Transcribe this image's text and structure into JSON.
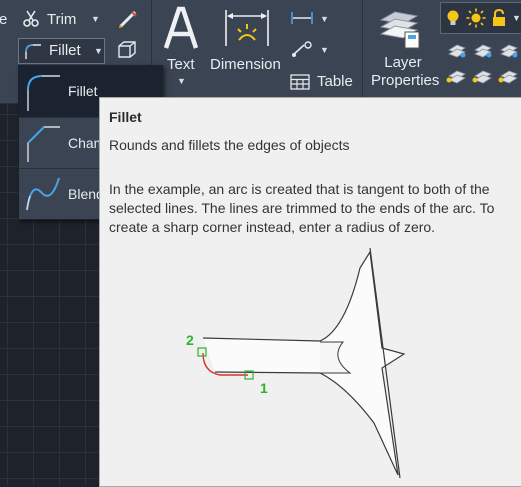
{
  "ribbon": {
    "trim_label": "Trim",
    "fillet_label": "Fillet",
    "text_label": "Text",
    "dimension_label": "Dimension",
    "table_label": "Table",
    "layer_properties_label": "Layer\nProperties",
    "cut_left_top": "e",
    "cut_left_mid": "y"
  },
  "flyout": {
    "items": [
      {
        "label": "Fillet",
        "selected": true
      },
      {
        "label": "Chamfer",
        "selected": false
      },
      {
        "label": "Blend Curves",
        "selected": false
      }
    ]
  },
  "tooltip": {
    "title": "Fillet",
    "subtitle": "Rounds and fillets the edges of objects",
    "description": "In the example, an arc is created that is tangent to both of the selected lines. The lines are trimmed to the ends of the arc. To create a sharp corner instead, enter a radius of zero.",
    "diagram": {
      "marker_1": "1",
      "marker_2": "2"
    }
  },
  "colors": {
    "ribbon_bg": "#3b4453",
    "canvas_bg": "#1e222a",
    "tooltip_bg": "#f0f0f0",
    "accent_blue": "#4aa3e8",
    "marker_green": "#2db32d",
    "arc_red": "#d9302b",
    "icon_yellow": "#f5c518"
  },
  "icons": [
    "scissors-icon",
    "fillet-icon",
    "chamfer-icon",
    "blend-curves-icon",
    "text-a-icon",
    "dimension-icon",
    "linear-dim-icon",
    "leader-icon",
    "table-icon",
    "layer-properties-icon",
    "lightbulb-icon",
    "sun-icon",
    "lock-icon",
    "layer-tool-icon"
  ]
}
